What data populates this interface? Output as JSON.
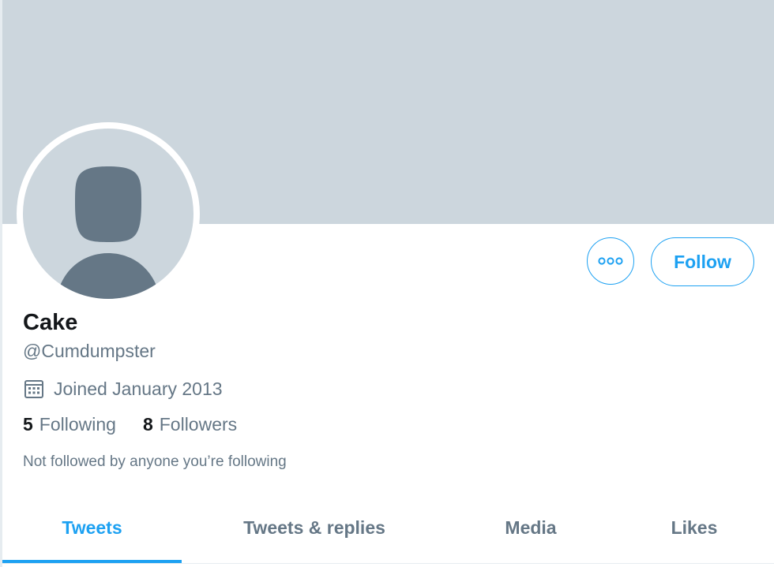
{
  "profile": {
    "display_name": "Cake",
    "handle": "@Cumdumpster",
    "joined": "Joined January 2013",
    "following_count": "5",
    "following_label": "Following",
    "followers_count": "8",
    "followers_label": "Followers",
    "not_followed_note": "Not followed by anyone you’re following"
  },
  "actions": {
    "more_icon": "more-horizontal-icon",
    "follow_label": "Follow"
  },
  "tabs": [
    {
      "label": "Tweets",
      "active": true
    },
    {
      "label": "Tweets & replies",
      "active": false
    },
    {
      "label": "Media",
      "active": false
    },
    {
      "label": "Likes",
      "active": false
    }
  ],
  "colors": {
    "accent": "#1da1f2",
    "banner": "#ccd6dd",
    "avatar_silhouette": "#657786",
    "secondary_text": "#657786",
    "primary_text": "#14171a"
  },
  "icons": {
    "calendar": "calendar-icon",
    "avatar": "default-avatar-icon"
  }
}
